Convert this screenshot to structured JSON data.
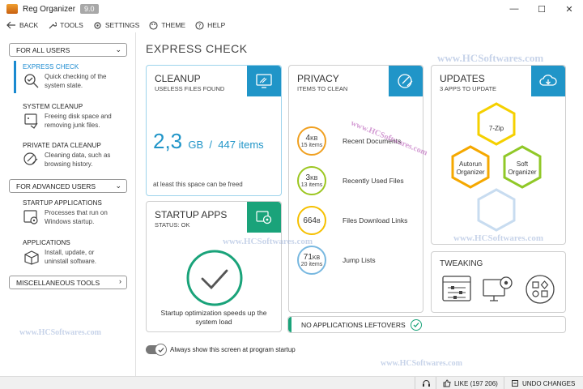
{
  "window": {
    "title": "Reg Organizer",
    "version": "9.0",
    "minimize": "—",
    "maximize": "☐",
    "close": "✕"
  },
  "toolbar": {
    "back": "BACK",
    "tools": "TOOLS",
    "settings": "SETTINGS",
    "theme": "THEME",
    "help": "HELP"
  },
  "sidebar": {
    "all_users": "FOR ALL USERS",
    "advanced_users": "FOR ADVANCED USERS",
    "misc_tools": "MISCELLANEOUS TOOLS",
    "items": [
      {
        "title": "EXPRESS CHECK",
        "desc1": "Quick checking of the",
        "desc2": "system state."
      },
      {
        "title": "SYSTEM CLEANUP",
        "desc1": "Freeing disk space and",
        "desc2": "removing junk files."
      },
      {
        "title": "PRIVATE DATA CLEANUP",
        "desc1": "Cleaning data, such as",
        "desc2": "browsing history."
      },
      {
        "title": "STARTUP APPLICATIONS",
        "desc1": "Processes that run on",
        "desc2": "Windows startup."
      },
      {
        "title": "APPLICATIONS",
        "desc1": "Install, update, or",
        "desc2": "uninstall software."
      }
    ]
  },
  "main": {
    "title": "EXPRESS CHECK"
  },
  "cleanup": {
    "title": "CLEANUP",
    "subtitle": "USELESS FILES FOUND",
    "size": "2,3",
    "unit": "GB",
    "separator": "/",
    "items": "447 items",
    "footer": "at least this space can be freed"
  },
  "startup": {
    "title": "STARTUP APPS",
    "status": "STATUS: OK",
    "footer1": "Startup optimization speeds up the",
    "footer2": "system load"
  },
  "privacy": {
    "title": "PRIVACY",
    "subtitle": "ITEMS TO CLEAN",
    "rows": [
      {
        "value": "4",
        "unit": "KB",
        "count": "15 items",
        "label": "Recent Documents",
        "color": "#f0a020"
      },
      {
        "value": "3",
        "unit": "KB",
        "count": "13 items",
        "label": "Recently Used Files",
        "color": "#9cc620"
      },
      {
        "value": "664",
        "unit": "B",
        "count": "",
        "label": "Files Download Links",
        "color": "#f5c000"
      },
      {
        "value": "71",
        "unit": "KB",
        "count": "20 items",
        "label": "Jump Lists",
        "color": "#78b8e0"
      }
    ]
  },
  "updates": {
    "title": "UPDATES",
    "subtitle": "3 APPS TO UPDATE",
    "apps": [
      "7-Zip",
      "Autorun Organizer",
      "Soft Organizer"
    ],
    "app_line": [
      "Autorun",
      "Organizer",
      "Soft",
      "Organizer"
    ]
  },
  "tweaking": {
    "title": "TWEAKING"
  },
  "leftovers": {
    "label": "NO APPLICATIONS LEFTOVERS"
  },
  "startup_toggle": {
    "label": "Always show this screen at program startup"
  },
  "statusbar": {
    "like": "LIKE (197 206)",
    "undo": "UNDO CHANGES"
  },
  "watermark": {
    "text": "www.HCSoftwares.com"
  },
  "colors": {
    "accent_blue": "#2095c8",
    "accent_green": "#1aa37a"
  }
}
